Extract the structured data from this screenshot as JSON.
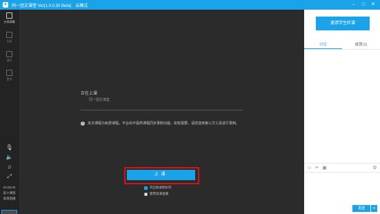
{
  "titlebar": {
    "title": "同一团文课堂 Ver(1.0.0.30 Beta)",
    "mode": "云模式",
    "controls": [
      "minimize-icon",
      "restore-icon",
      "close-icon"
    ]
  },
  "rail": {
    "items": [
      {
        "label": "分享屏幕",
        "icon": "share-screen-icon"
      },
      {
        "label": "白板",
        "icon": "whiteboard-icon"
      },
      {
        "label": "课件",
        "icon": "courseware-icon"
      },
      {
        "label": "更多",
        "icon": "more-icon"
      }
    ],
    "controls": [
      "microphone-icon",
      "speaker-icon",
      "music-icon",
      "fullscreen-icon"
    ],
    "timer": "00:00:00",
    "teacher_label": "第十课程",
    "status_label": "高清直播"
  },
  "stage": {
    "status": "正在上课",
    "course_name": "同一团文课堂",
    "notice": "本次课程为免费课程，平台尚不提供课程同步录制功能。如有需要，请您选用第三方工具进行录制。",
    "start_button": "上课",
    "checkbox_watermark": "开启防录制水印",
    "checkbox_hd": "使用高清直播",
    "checkbox_watermark_checked": true,
    "checkbox_hd_checked": false
  },
  "panel": {
    "invite_button": "邀请学生听课",
    "tabs": [
      {
        "label": "讨论",
        "active": true
      },
      {
        "label": "成员(1)",
        "active": false
      }
    ],
    "toolbar_icons": [
      "emoji-icon",
      "scissors-icon",
      "image-icon",
      "gear-icon"
    ],
    "send_button": "发送",
    "send_more": "▾"
  },
  "colors": {
    "accent": "#1aa3e8",
    "highlight": "#dd1111"
  }
}
